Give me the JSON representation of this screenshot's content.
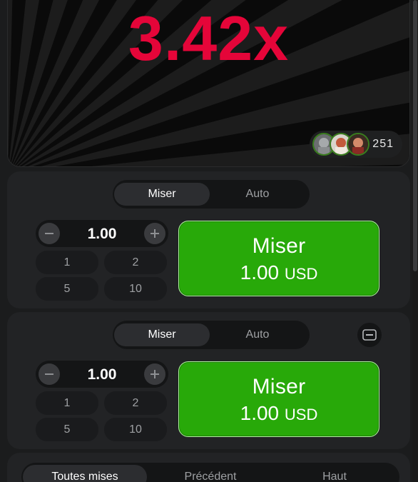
{
  "game": {
    "multiplier": "3.42x",
    "player_count": "251",
    "multiplier_color": "#e50539"
  },
  "panels": [
    {
      "tabs": [
        "Miser",
        "Auto"
      ],
      "active_tab": "Miser",
      "stake": "1.00",
      "quick_amounts": [
        "1",
        "2",
        "5",
        "10"
      ],
      "bet_label": "Miser",
      "bet_amount": "1.00",
      "currency": "USD"
    },
    {
      "tabs": [
        "Miser",
        "Auto"
      ],
      "active_tab": "Miser",
      "stake": "1.00",
      "quick_amounts": [
        "1",
        "2",
        "5",
        "10"
      ],
      "bet_label": "Miser",
      "bet_amount": "1.00",
      "currency": "USD"
    }
  ],
  "history_tabs": [
    "Toutes mises",
    "Précédent",
    "Haut"
  ],
  "colors": {
    "bet_button": "#28a909",
    "background": "#1b1c1d"
  },
  "icons": {
    "minus": "minus-icon",
    "plus": "plus-icon",
    "remove_panel": "remove-panel-icon"
  }
}
